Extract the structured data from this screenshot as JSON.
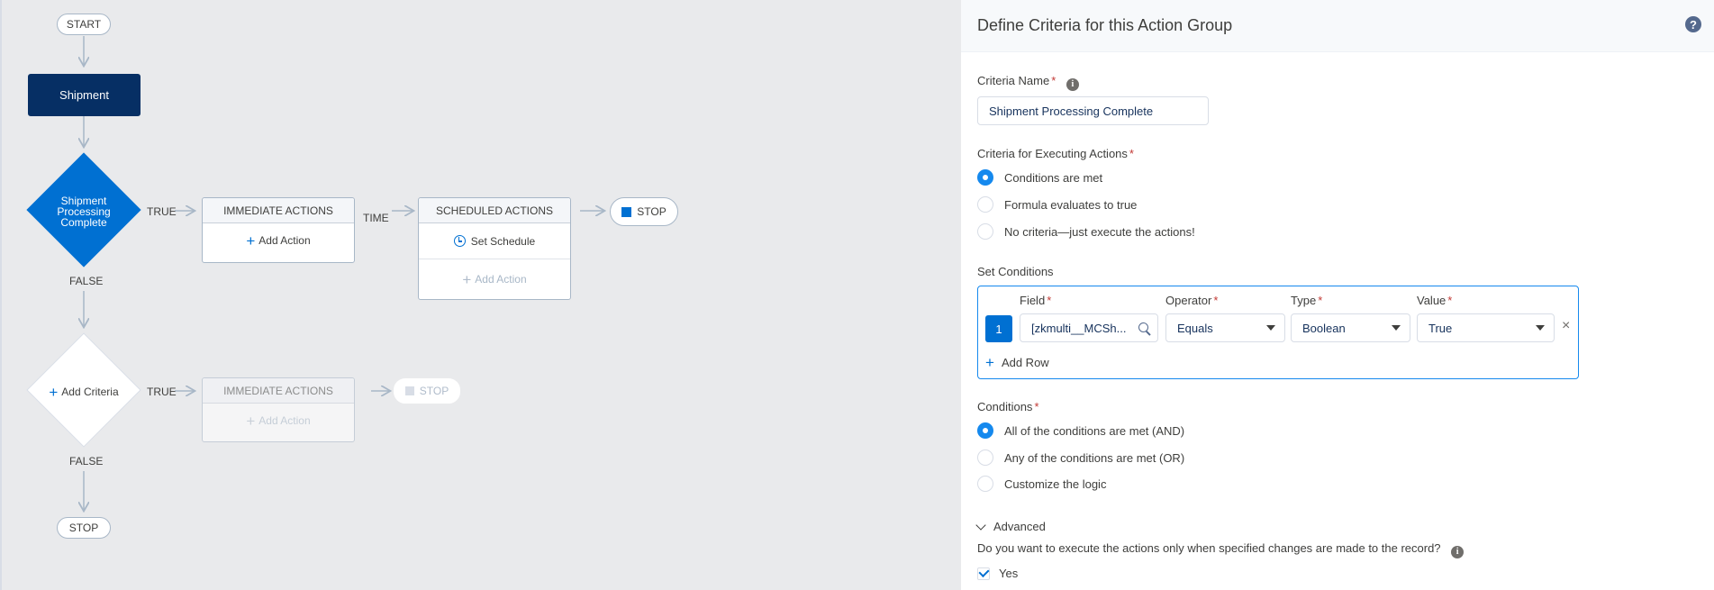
{
  "flow": {
    "start_label": "START",
    "object_node": "Shipment",
    "criteria_node": "Shipment Processing Complete",
    "true_label": "TRUE",
    "false_label": "FALSE",
    "time_label": "TIME",
    "immediate_actions_header": "IMMEDIATE ACTIONS",
    "scheduled_actions_header": "SCHEDULED ACTIONS",
    "add_action_label": "Add Action",
    "set_schedule_label": "Set Schedule",
    "stop_label": "STOP",
    "add_criteria_label": "Add Criteria"
  },
  "panel": {
    "title": "Define Criteria for this Action Group",
    "criteria_name_label": "Criteria Name",
    "criteria_name_value": "Shipment Processing Complete",
    "criteria_exec_label": "Criteria for Executing Actions",
    "criteria_exec_options": [
      "Conditions are met",
      "Formula evaluates to true",
      "No criteria—just execute the actions!"
    ],
    "criteria_exec_selected": 0,
    "set_conditions_label": "Set Conditions",
    "columns": {
      "field": "Field",
      "operator": "Operator",
      "type": "Type",
      "value": "Value"
    },
    "row": {
      "number": "1",
      "field": "[zkmulti__MCSh...",
      "operator": "Equals",
      "type": "Boolean",
      "value": "True"
    },
    "add_row_label": "Add Row",
    "conditions_label": "Conditions",
    "conditions_options": [
      "All of the conditions are met (AND)",
      "Any of the conditions are met (OR)",
      "Customize the logic"
    ],
    "conditions_selected": 0,
    "advanced_label": "Advanced",
    "advanced_question": "Do you want to execute the actions only when specified changes are made to the record?",
    "yes_label": "Yes",
    "yes_checked": true
  },
  "colors": {
    "accent": "#1589ee",
    "node_dark": "#062f64",
    "node_blue": "#0070d2"
  }
}
